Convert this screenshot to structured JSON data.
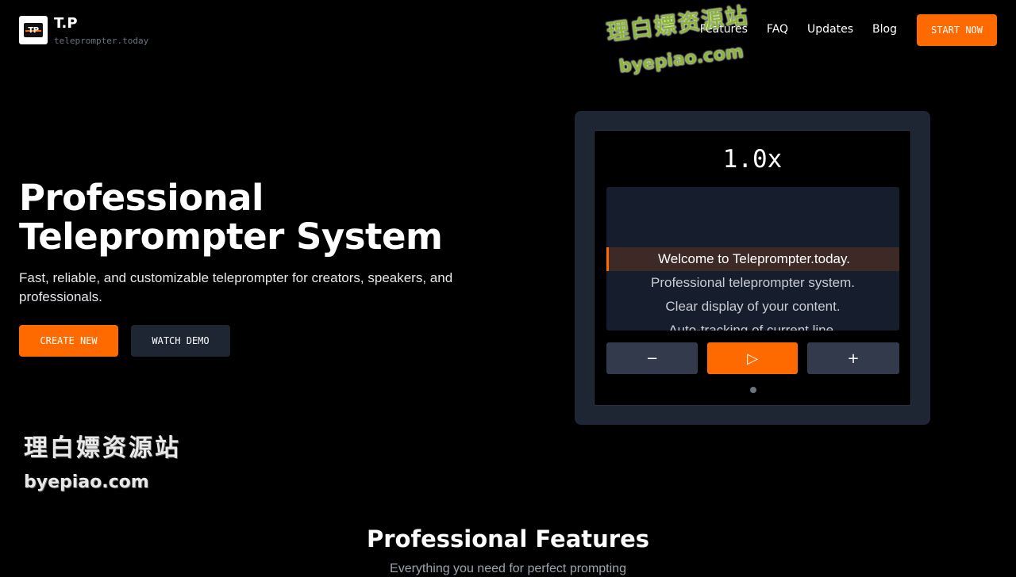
{
  "header": {
    "logo_text": "TP",
    "brand_name": "T.P",
    "brand_domain": "teleprompter.today",
    "nav": [
      "Features",
      "FAQ",
      "Updates",
      "Blog"
    ],
    "start_label": "START NOW"
  },
  "hero": {
    "title_line1": "Professional",
    "title_line2": "Teleprompter System",
    "subtitle": "Fast, reliable, and customizable teleprompter for creators, speakers, and professionals.",
    "create_label": "CREATE NEW",
    "demo_label": "WATCH DEMO"
  },
  "device": {
    "speed": "1.0x",
    "script_lines": [
      "Welcome to Teleprompter.today.",
      "Professional teleprompter system.",
      "Clear display of your content.",
      "Auto-tracking of current line."
    ],
    "active_line": 0,
    "minus_symbol": "−",
    "play_symbol": "▷",
    "plus_symbol": "+"
  },
  "watermark": {
    "cn": "理白嫖资源站",
    "en": "byepiao.com"
  },
  "features": {
    "title": "Professional Features",
    "subtitle": "Everything you need for perfect prompting"
  },
  "colors": {
    "accent": "#ff6a00",
    "background": "#000000",
    "panel": "#1e2533"
  }
}
